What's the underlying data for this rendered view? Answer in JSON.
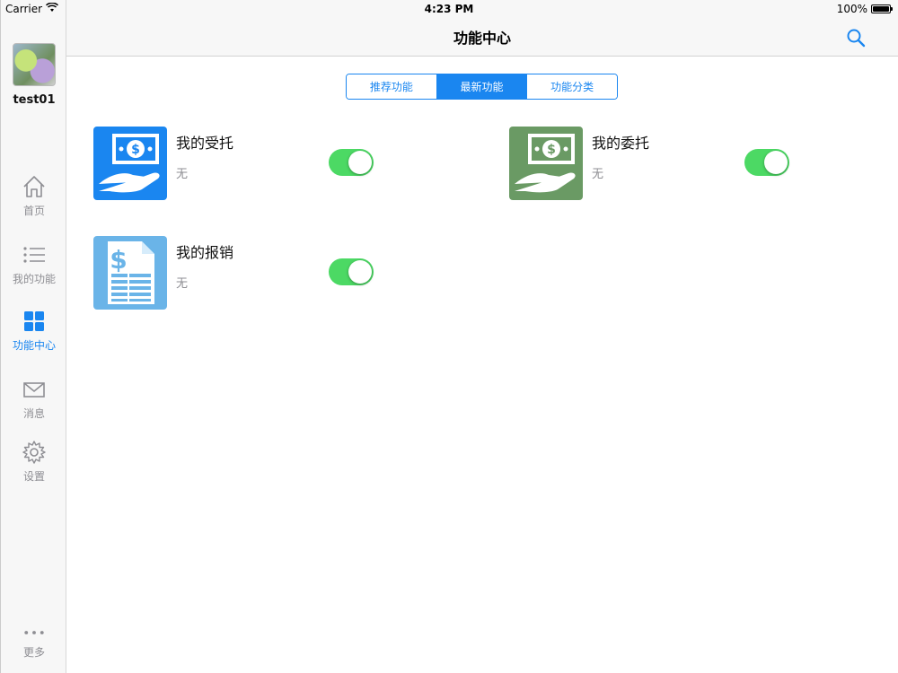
{
  "status_bar": {
    "carrier": "Carrier",
    "time": "4:23 PM",
    "battery": "100%"
  },
  "sidebar": {
    "username": "test01",
    "items": [
      {
        "label": "首页",
        "icon": "home-icon",
        "active": false
      },
      {
        "label": "我的功能",
        "icon": "list-icon",
        "active": false
      },
      {
        "label": "功能中心",
        "icon": "grid-icon",
        "active": true
      },
      {
        "label": "消息",
        "icon": "mail-icon",
        "active": false
      },
      {
        "label": "设置",
        "icon": "gear-icon",
        "active": false
      }
    ],
    "more": {
      "label": "更多",
      "icon": "more-dots-icon"
    }
  },
  "header": {
    "title": "功能中心",
    "search_icon": "search-icon"
  },
  "tabs": [
    {
      "label": "推荐功能",
      "active": false
    },
    {
      "label": "最新功能",
      "active": true
    },
    {
      "label": "功能分类",
      "active": false
    }
  ],
  "functions": [
    {
      "title": "我的受托",
      "subtitle": "无",
      "enabled": true,
      "icon": "money-hand-icon",
      "color": "#1a86f0"
    },
    {
      "title": "我的委托",
      "subtitle": "无",
      "enabled": true,
      "icon": "money-hand-icon",
      "color": "#6a9a64"
    },
    {
      "title": "我的报销",
      "subtitle": "无",
      "enabled": true,
      "icon": "invoice-icon",
      "color": "#6ab4e8"
    }
  ],
  "colors": {
    "accent": "#1a86f0",
    "toggle_on": "#4cd964",
    "inactive_text": "#8e8e93"
  }
}
